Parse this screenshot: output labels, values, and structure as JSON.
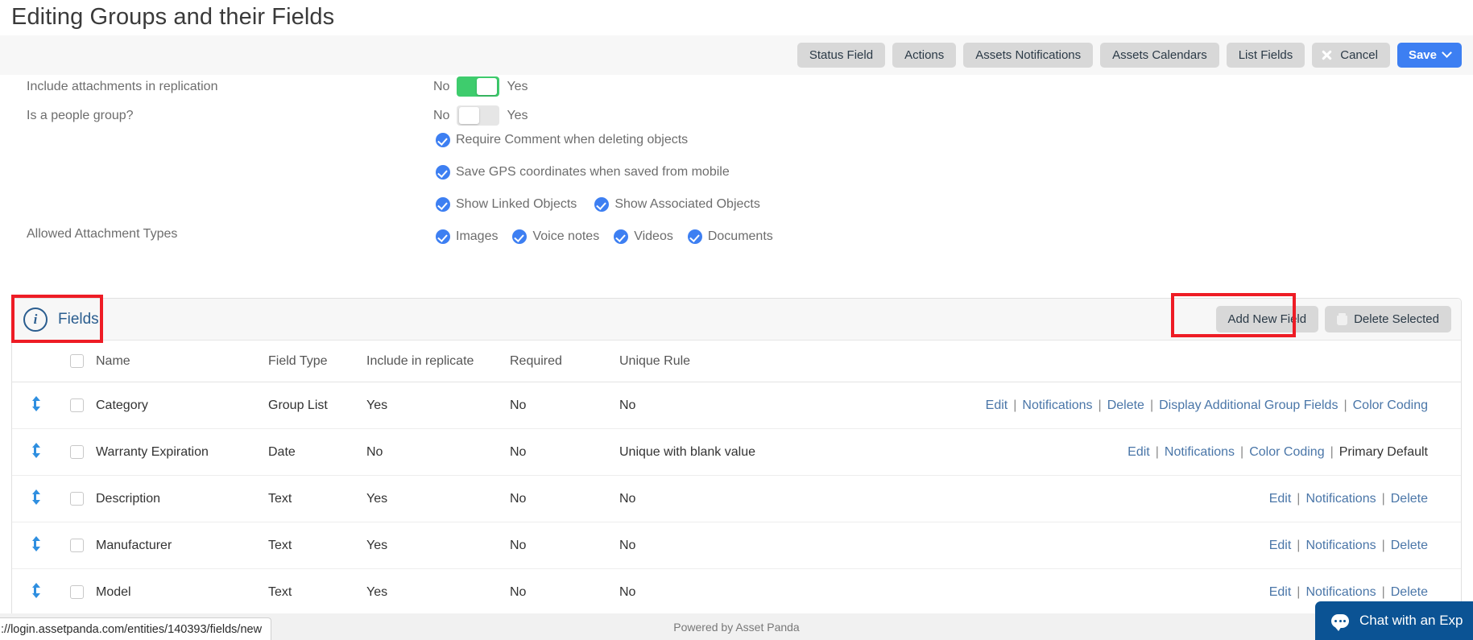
{
  "page_title": "Editing Groups and their Fields",
  "toolbar": {
    "status_field": "Status Field",
    "actions": "Actions",
    "assets_notifications": "Assets Notifications",
    "assets_calendars": "Assets Calendars",
    "list_fields": "List Fields",
    "cancel": "Cancel",
    "save": "Save"
  },
  "settings": {
    "include_attachments_label": "Include attachments in replication",
    "include_attachments_off": "No",
    "include_attachments_on": "Yes",
    "include_attachments_state": "on",
    "people_group_label": "Is a people group?",
    "people_group_off": "No",
    "people_group_on": "Yes",
    "people_group_state": "off",
    "require_comment": "Require Comment when deleting objects",
    "save_gps": "Save GPS coordinates when saved from mobile",
    "show_linked": "Show Linked Objects",
    "show_associated": "Show Associated Objects",
    "attachment_types_label": "Allowed Attachment Types",
    "attachment_images": "Images",
    "attachment_voice": "Voice notes",
    "attachment_videos": "Videos",
    "attachment_documents": "Documents"
  },
  "fields_panel": {
    "title": "Fields",
    "add_new_field": "Add New Field",
    "delete_selected": "Delete Selected",
    "columns": {
      "name": "Name",
      "field_type": "Field Type",
      "include_in_replicate": "Include in replicate",
      "required": "Required",
      "unique_rule": "Unique Rule"
    },
    "rows": [
      {
        "name": "Category",
        "field_type": "Group List",
        "include_in_replicate": "Yes",
        "required": "No",
        "unique_rule": "No",
        "actions": [
          {
            "label": "Edit",
            "link": true
          },
          {
            "label": "Notifications",
            "link": true
          },
          {
            "label": "Delete",
            "link": true
          },
          {
            "label": "Display Additional Group Fields",
            "link": true
          },
          {
            "label": "Color Coding",
            "link": true
          }
        ]
      },
      {
        "name": "Warranty Expiration",
        "field_type": "Date",
        "include_in_replicate": "No",
        "required": "No",
        "unique_rule": "Unique with blank value",
        "actions": [
          {
            "label": "Edit",
            "link": true
          },
          {
            "label": "Notifications",
            "link": true
          },
          {
            "label": "Color Coding",
            "link": true
          },
          {
            "label": "Primary Default",
            "link": false
          }
        ]
      },
      {
        "name": "Description",
        "field_type": "Text",
        "include_in_replicate": "Yes",
        "required": "No",
        "unique_rule": "No",
        "actions": [
          {
            "label": "Edit",
            "link": true
          },
          {
            "label": "Notifications",
            "link": true
          },
          {
            "label": "Delete",
            "link": true
          }
        ]
      },
      {
        "name": "Manufacturer",
        "field_type": "Text",
        "include_in_replicate": "Yes",
        "required": "No",
        "unique_rule": "No",
        "actions": [
          {
            "label": "Edit",
            "link": true
          },
          {
            "label": "Notifications",
            "link": true
          },
          {
            "label": "Delete",
            "link": true
          }
        ]
      },
      {
        "name": "Model",
        "field_type": "Text",
        "include_in_replicate": "Yes",
        "required": "No",
        "unique_rule": "No",
        "actions": [
          {
            "label": "Edit",
            "link": true
          },
          {
            "label": "Notifications",
            "link": true
          },
          {
            "label": "Delete",
            "link": true
          }
        ]
      }
    ]
  },
  "footer": {
    "powered_by": "Powered by Asset Panda",
    "status_url": "://login.assetpanda.com/entities/140393/fields/new",
    "chat_label": "Chat with an Exp"
  }
}
